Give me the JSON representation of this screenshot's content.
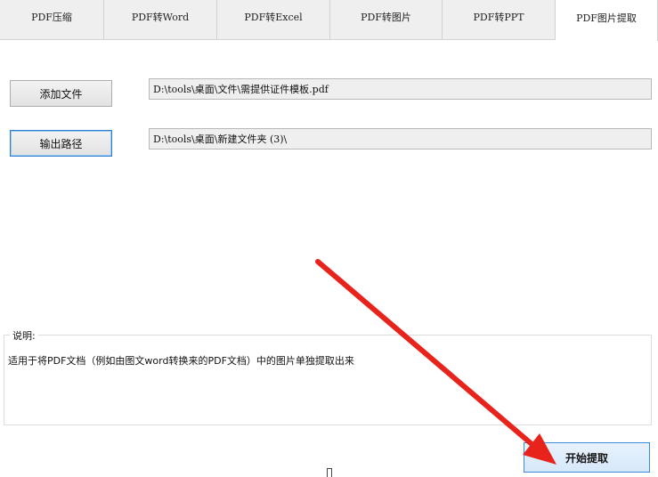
{
  "tabs": [
    {
      "label": "PDF压缩",
      "active": false
    },
    {
      "label": "PDF转Word",
      "active": false
    },
    {
      "label": "PDF转Excel",
      "active": false
    },
    {
      "label": "PDF转图片",
      "active": false
    },
    {
      "label": "PDF转PPT",
      "active": false
    },
    {
      "label": "PDF图片提取",
      "active": true
    }
  ],
  "add_file": {
    "button_label": "添加文件",
    "path": "D:\\tools\\桌面\\文件\\需提供证件模板.pdf"
  },
  "output": {
    "button_label": "输出路径",
    "path": "D:\\tools\\桌面\\新建文件夹 (3)\\"
  },
  "description": {
    "legend": "说明:",
    "text": "适用于将PDF文档（例如由图文word转换来的PDF文档）中的图片单独提取出来"
  },
  "start_button_label": "开始提取",
  "colors": {
    "annotation_arrow": "#e8231c",
    "primary_border": "#3c8ad8"
  }
}
